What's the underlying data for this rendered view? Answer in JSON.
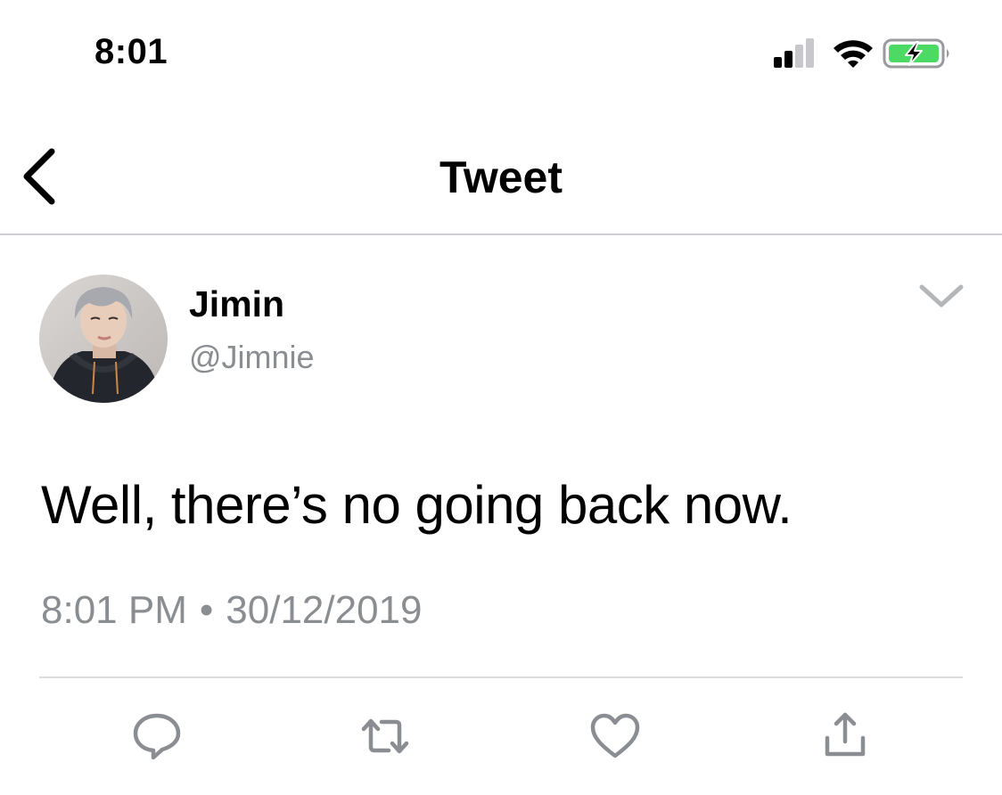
{
  "status_bar": {
    "time": "8:01",
    "icons": [
      "cellular-signal-icon",
      "wifi-icon",
      "battery-charging-icon"
    ],
    "battery_color": "#4cd964"
  },
  "nav": {
    "title": "Tweet",
    "back_icon": "chevron-left-icon"
  },
  "tweet": {
    "display_name": "Jimin",
    "handle": "@Jimnie",
    "menu_icon": "chevron-down-icon",
    "text": "Well, there’s no going back now.",
    "time": "8:01 PM",
    "separator": "•",
    "date": "30/12/2019"
  },
  "actions": [
    {
      "name": "reply",
      "icon": "reply-bubble-icon"
    },
    {
      "name": "retweet",
      "icon": "retweet-icon"
    },
    {
      "name": "like",
      "icon": "heart-icon"
    },
    {
      "name": "share",
      "icon": "share-icon"
    }
  ],
  "colors": {
    "text": "#000000",
    "secondary_text": "#8a8d91",
    "divider": "#cfcfd4",
    "icon_gray": "#8a8d91"
  }
}
